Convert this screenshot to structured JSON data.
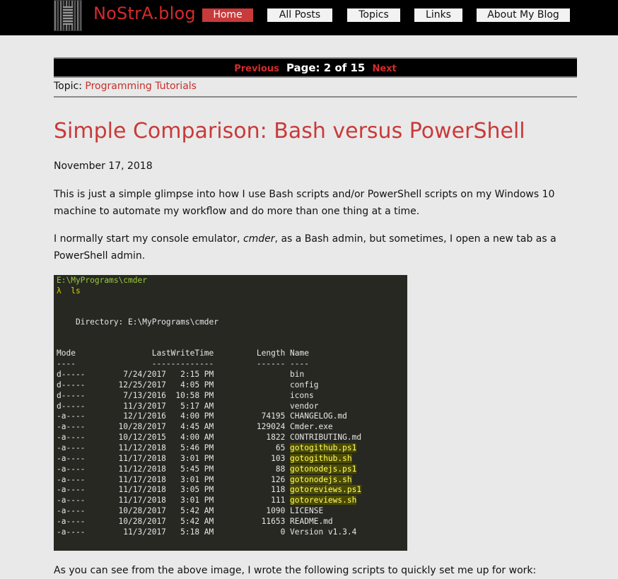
{
  "header": {
    "site_title": "NoStrA.blog",
    "logo_icon": "logo-icon",
    "nav": [
      {
        "label": "Home",
        "active": true
      },
      {
        "label": "All Posts",
        "active": false
      },
      {
        "label": "Topics",
        "active": false
      },
      {
        "label": "Links",
        "active": false
      },
      {
        "label": "About My Blog",
        "active": false
      }
    ]
  },
  "pager": {
    "previous": "Previous",
    "page_info": "Page: 2 of 15",
    "next": "Next"
  },
  "topic": {
    "label": "Topic: ",
    "value": "Programming Tutorials"
  },
  "post": {
    "title": "Simple Comparison: Bash versus PowerShell",
    "date": "November 17, 2018",
    "para1": "This is just a simple glimpse into how I use Bash scripts and/or PowerShell scripts on my Windows 10 machine to automate my workflow and do more than one thing at a time.",
    "para2_before": "I normally start my console emulator, ",
    "para2_em": "cmder",
    "para2_after": ", as a Bash admin, but sometimes, I open a new tab as a PowerShell admin.",
    "para3": "As you can see from the above image, I wrote the following scripts to quickly set me up for work:"
  },
  "terminal": {
    "path": "E:\\MyPrograms\\cmder",
    "prompt": "λ  ls",
    "directory": "    Directory: E:\\MyPrograms\\cmder",
    "header": "Mode                LastWriteTime         Length Name",
    "divider": "----                -------------         ------ ----",
    "rows": [
      {
        "text": "d-----        7/24/2017   2:15 PM                ",
        "name": "bin",
        "hl": false
      },
      {
        "text": "d-----       12/25/2017   4:05 PM                ",
        "name": "config",
        "hl": false
      },
      {
        "text": "d-----        7/13/2016  10:58 PM                ",
        "name": "icons",
        "hl": false
      },
      {
        "text": "d-----        11/3/2017   5:17 AM                ",
        "name": "vendor",
        "hl": false
      },
      {
        "text": "-a----        12/1/2016   4:00 PM          74195 ",
        "name": "CHANGELOG.md",
        "hl": false
      },
      {
        "text": "-a----       10/28/2017   4:45 AM         129024 ",
        "name": "Cmder.exe",
        "hl": false
      },
      {
        "text": "-a----       10/12/2015   4:00 AM           1822 ",
        "name": "CONTRIBUTING.md",
        "hl": false
      },
      {
        "text": "-a----       11/12/2018   5:46 PM             65 ",
        "name": "gotogithub.ps1",
        "hl": true
      },
      {
        "text": "-a----       11/17/2018   3:01 PM            103 ",
        "name": "gotogithub.sh",
        "hl": true
      },
      {
        "text": "-a----       11/12/2018   5:45 PM             88 ",
        "name": "gotonodejs.ps1",
        "hl": true
      },
      {
        "text": "-a----       11/17/2018   3:01 PM            126 ",
        "name": "gotonodejs.sh",
        "hl": true
      },
      {
        "text": "-a----       11/17/2018   3:05 PM            118 ",
        "name": "gotoreviews.ps1",
        "hl": true
      },
      {
        "text": "-a----       11/17/2018   3:01 PM            111 ",
        "name": "gotoreviews.sh",
        "hl": true
      },
      {
        "text": "-a----       10/28/2017   5:42 AM           1090 ",
        "name": "LICENSE",
        "hl": false
      },
      {
        "text": "-a----       10/28/2017   5:42 AM          11653 ",
        "name": "README.md",
        "hl": false
      },
      {
        "text": "-a----        11/3/2017   5:18 AM              0 ",
        "name": "Version v1.3.4",
        "hl": false
      }
    ]
  }
}
